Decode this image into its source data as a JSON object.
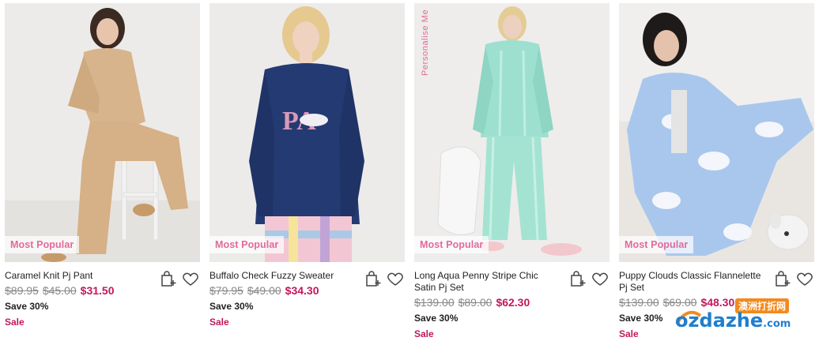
{
  "products": [
    {
      "title": "Caramel Knit Pj Pant",
      "original_price": "$89.95",
      "previous_price": "$45.00",
      "current_price": "$31.50",
      "save_text": "Save 30%",
      "sale_label": "Sale",
      "badge": "Most Popular",
      "personalise_label": null
    },
    {
      "title": "Buffalo Check Fuzzy Sweater",
      "original_price": "$79.95",
      "previous_price": "$49.00",
      "current_price": "$34.30",
      "save_text": "Save 30%",
      "sale_label": "Sale",
      "badge": "Most Popular",
      "personalise_label": null
    },
    {
      "title": "Long Aqua Penny Stripe Chic Satin Pj Set",
      "original_price": "$139.00",
      "previous_price": "$89.00",
      "current_price": "$62.30",
      "save_text": "Save 30%",
      "sale_label": "Sale",
      "badge": "Most Popular",
      "personalise_label": "Personalise Me"
    },
    {
      "title": "Puppy Clouds Classic Flannelette Pj Set",
      "original_price": "$139.00",
      "previous_price": "$69.00",
      "current_price": "$48.30",
      "save_text": "Save 30%",
      "sale_label": "Sale",
      "badge": "Most Popular",
      "personalise_label": null
    }
  ],
  "icons": {
    "add_to_bag": "shopping-bag-plus-icon",
    "wishlist": "heart-icon"
  },
  "colors": {
    "accent_pink": "#c2185b",
    "badge_pink": "#e26a9b",
    "strike_grey": "#888888"
  },
  "watermark": {
    "cn_text": "澳洲打折网",
    "logo": "ozdazhe",
    "tld": ".com"
  }
}
